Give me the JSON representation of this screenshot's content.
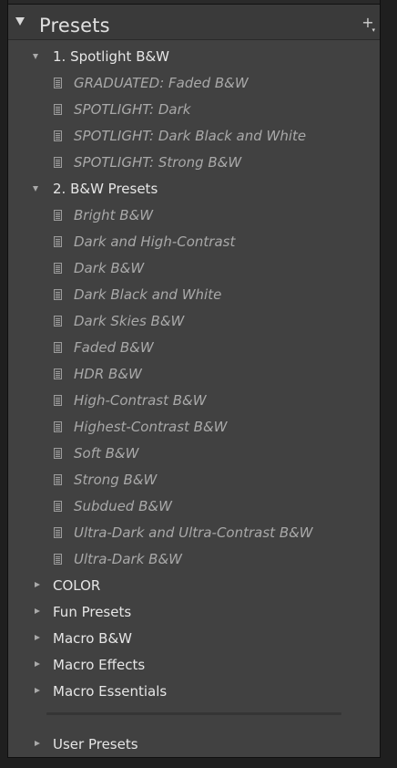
{
  "panel": {
    "title": "Presets",
    "add_icon": "+",
    "add_icon_sub": "▾"
  },
  "folders": [
    {
      "label": "1. Spotlight B&W",
      "expanded": true,
      "items": [
        "GRADUATED: Faded B&W",
        "SPOTLIGHT: Dark",
        "SPOTLIGHT: Dark Black and White",
        "SPOTLIGHT: Strong B&W"
      ]
    },
    {
      "label": "2. B&W Presets",
      "expanded": true,
      "items": [
        "Bright B&W",
        "Dark and High-Contrast",
        "Dark B&W",
        "Dark Black and White",
        "Dark Skies B&W",
        "Faded B&W",
        "HDR B&W",
        "High-Contrast B&W",
        "Highest-Contrast B&W",
        "Soft B&W",
        "Strong B&W",
        "Subdued B&W",
        "Ultra-Dark and Ultra-Contrast B&W",
        "Ultra-Dark B&W"
      ]
    },
    {
      "label": "COLOR",
      "expanded": false,
      "items": []
    },
    {
      "label": "Fun Presets",
      "expanded": false,
      "items": []
    },
    {
      "label": "Macro B&W",
      "expanded": false,
      "items": []
    },
    {
      "label": "Macro Effects",
      "expanded": false,
      "items": []
    },
    {
      "label": "Macro Essentials",
      "expanded": false,
      "items": []
    }
  ],
  "user_folder": {
    "label": "User Presets",
    "expanded": false
  },
  "colors": {
    "panel_bg": "#414141",
    "header_bg": "#3a3a3a",
    "folder_text": "#e6e6e6",
    "preset_text": "#a9a9a9"
  }
}
